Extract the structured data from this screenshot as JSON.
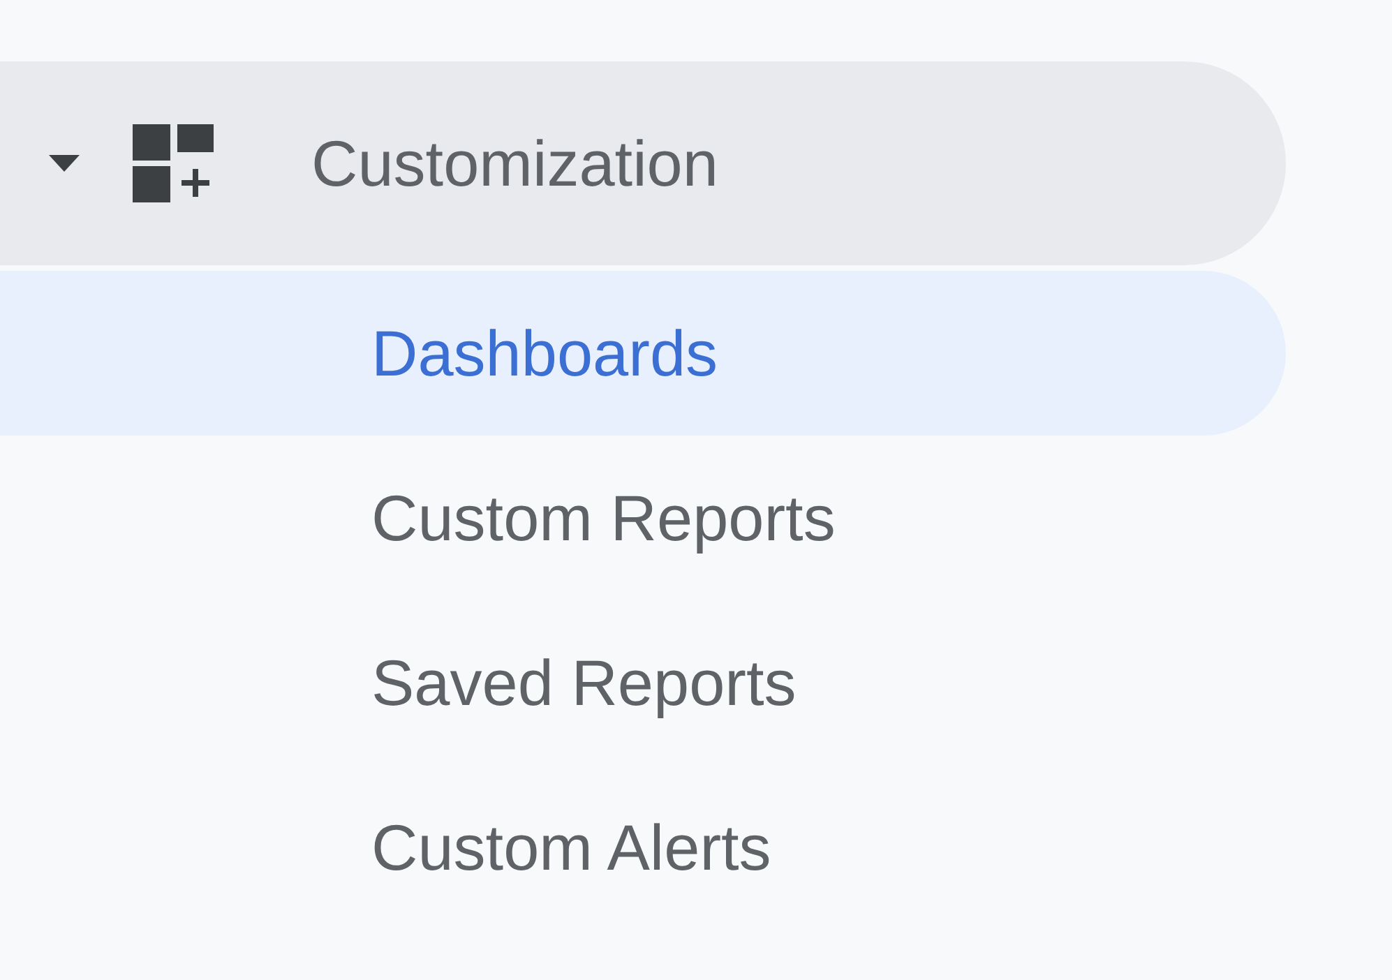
{
  "section": {
    "title": "Customization",
    "expanded": true,
    "items": [
      {
        "label": "Dashboards",
        "selected": true
      },
      {
        "label": "Custom Reports",
        "selected": false
      },
      {
        "label": "Saved Reports",
        "selected": false
      },
      {
        "label": "Custom Alerts",
        "selected": false
      }
    ]
  }
}
